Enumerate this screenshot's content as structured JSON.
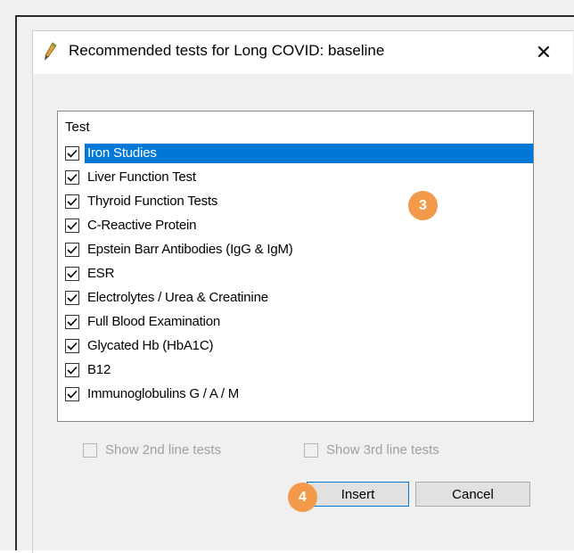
{
  "dialog": {
    "title": "Recommended tests for Long COVID: baseline",
    "close_glyph": "✕",
    "icon": "pen-nib-icon"
  },
  "list": {
    "header": "Test",
    "items": [
      {
        "label": "Iron Studies",
        "checked": true,
        "selected": true
      },
      {
        "label": "Liver Function Test",
        "checked": true,
        "selected": false
      },
      {
        "label": "Thyroid Function Tests",
        "checked": true,
        "selected": false
      },
      {
        "label": "C-Reactive Protein",
        "checked": true,
        "selected": false
      },
      {
        "label": "Epstein Barr Antibodies (IgG & IgM)",
        "checked": true,
        "selected": false
      },
      {
        "label": "ESR",
        "checked": true,
        "selected": false
      },
      {
        "label": "Electrolytes / Urea & Creatinine",
        "checked": true,
        "selected": false
      },
      {
        "label": "Full Blood Examination",
        "checked": true,
        "selected": false
      },
      {
        "label": "Glycated Hb (HbA1C)",
        "checked": true,
        "selected": false
      },
      {
        "label": "B12",
        "checked": true,
        "selected": false
      },
      {
        "label": "Immunoglobulins  G / A / M",
        "checked": true,
        "selected": false
      }
    ]
  },
  "options": {
    "second_line": {
      "label": "Show 2nd line tests",
      "checked": false,
      "enabled": false
    },
    "third_line": {
      "label": "Show 3rd line tests",
      "checked": false,
      "enabled": false
    }
  },
  "buttons": {
    "insert": "Insert",
    "cancel": "Cancel"
  },
  "badges": {
    "list_step": "3",
    "insert_step": "4"
  },
  "colors": {
    "selection": "#0078d7",
    "badge": "#f2994a"
  }
}
